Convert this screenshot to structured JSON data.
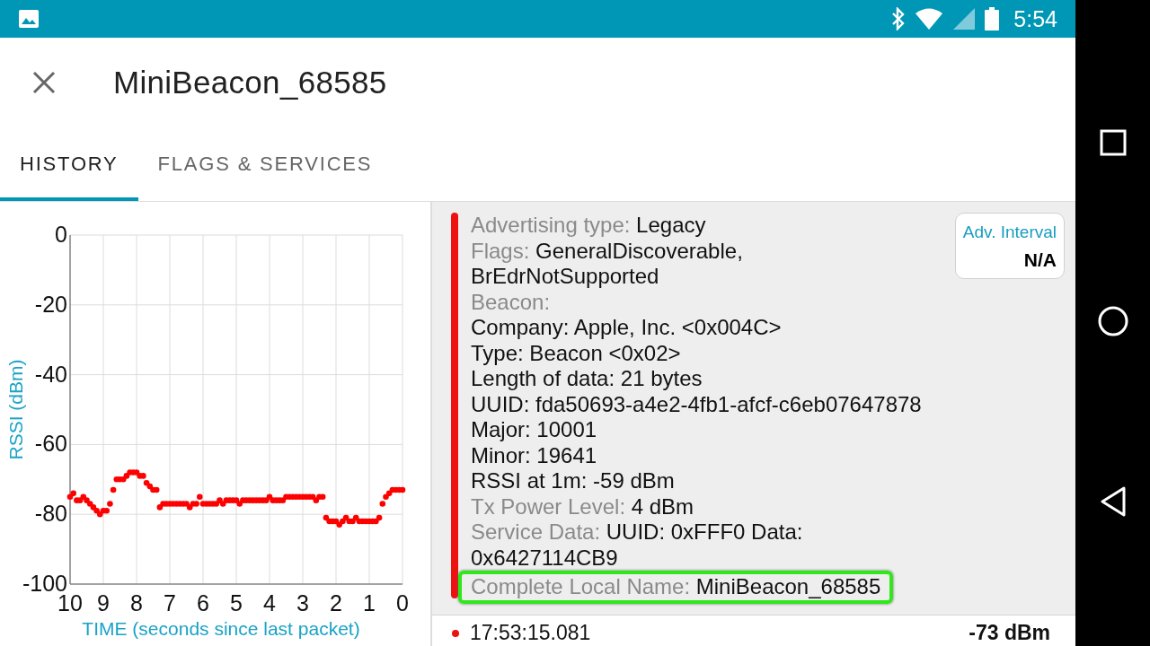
{
  "status_bar": {
    "time": "5:54"
  },
  "app_bar": {
    "title": "MiniBeacon_68585"
  },
  "tabs": [
    {
      "label": "HISTORY",
      "selected": true
    },
    {
      "label": "FLAGS & SERVICES",
      "selected": false
    }
  ],
  "history_chart": {
    "chart_data": {
      "type": "scatter",
      "grid": true,
      "xlabel": "TIME (seconds since last packet)",
      "ylabel": "RSSI (dBm)",
      "xlim": [
        10,
        0
      ],
      "ylim": [
        -100,
        0
      ],
      "xticks": [
        10,
        9,
        8,
        7,
        6,
        5,
        4,
        3,
        2,
        1,
        0
      ],
      "yticks": [
        0,
        -20,
        -40,
        -60,
        -80,
        -100
      ],
      "x": [
        10,
        9.9,
        9.8,
        9.7,
        9.6,
        9.5,
        9.4,
        9.3,
        9.2,
        9.1,
        9,
        8.9,
        8.8,
        8.7,
        8.6,
        8.5,
        8.4,
        8.3,
        8.2,
        8.1,
        8,
        7.9,
        7.8,
        7.7,
        7.6,
        7.5,
        7.4,
        7.3,
        7.2,
        7.1,
        7,
        6.9,
        6.8,
        6.7,
        6.6,
        6.5,
        6.4,
        6.3,
        6.2,
        6.1,
        6,
        5.9,
        5.8,
        5.7,
        5.6,
        5.5,
        5.4,
        5.3,
        5.2,
        5.1,
        5,
        4.9,
        4.8,
        4.7,
        4.6,
        4.5,
        4.4,
        4.3,
        4.2,
        4.1,
        4,
        3.9,
        3.8,
        3.7,
        3.6,
        3.5,
        3.4,
        3.3,
        3.2,
        3.1,
        3,
        2.9,
        2.8,
        2.7,
        2.6,
        2.5,
        2.4,
        2.3,
        2.2,
        2.1,
        2,
        1.9,
        1.8,
        1.7,
        1.6,
        1.5,
        1.4,
        1.3,
        1.2,
        1.1,
        1,
        0.9,
        0.8,
        0.7,
        0.6,
        0.5,
        0.4,
        0.3,
        0.2,
        0.1,
        0
      ],
      "series": [
        {
          "color": "#ff0000",
          "values": [
            -75,
            -74,
            -76,
            -76,
            -75,
            -76,
            -77,
            -78,
            -79,
            -80,
            -79,
            -79,
            -77,
            -73,
            -70,
            -70,
            -70,
            -69,
            -68,
            -68,
            -68,
            -69,
            -69,
            -71,
            -72,
            -73,
            -73,
            -78,
            -77,
            -77,
            -77,
            -77,
            -77,
            -77,
            -77,
            -77,
            -78,
            -77,
            -77,
            -75,
            -77,
            -77,
            -77,
            -77,
            -77,
            -76,
            -77,
            -76,
            -76,
            -76,
            -76,
            -77,
            -76,
            -76,
            -76,
            -76,
            -76,
            -76,
            -76,
            -76,
            -75,
            -76,
            -76,
            -76,
            -76,
            -75,
            -75,
            -75,
            -75,
            -75,
            -75,
            -75,
            -75,
            -75,
            -76,
            -75,
            -75,
            -81,
            -82,
            -82,
            -82,
            -83,
            -82,
            -81,
            -82,
            -82,
            -81,
            -82,
            -82,
            -82,
            -82,
            -82,
            -82,
            -81,
            -77,
            -75,
            -74,
            -73,
            -73,
            -73,
            -73
          ]
        }
      ]
    }
  },
  "packet": {
    "lines": [
      {
        "label": "Advertising type:",
        "value": "Legacy",
        "highlighted": false
      },
      {
        "label": "Flags:",
        "value": "GeneralDiscoverable, BrEdrNotSupported",
        "highlighted": false
      },
      {
        "label": "Beacon:",
        "highlighted": false
      },
      {
        "value": "Company: Apple, Inc. <0x004C>",
        "highlighted": false
      },
      {
        "value": "Type: Beacon <0x02>",
        "highlighted": false
      },
      {
        "value": "Length of data: 21 bytes",
        "highlighted": false
      },
      {
        "value": "UUID: fda50693-a4e2-4fb1-afcf-c6eb07647878",
        "highlighted": false
      },
      {
        "value": "Major: 10001",
        "highlighted": false
      },
      {
        "value": "Minor: 19641",
        "highlighted": false
      },
      {
        "value": "RSSI at 1m: -59 dBm",
        "highlighted": false
      },
      {
        "label": "Tx Power Level:",
        "value": "4 dBm",
        "highlighted": false
      },
      {
        "label": "Service Data:",
        "value": "UUID: 0xFFF0 Data: 0x6427114CB9",
        "highlighted": false
      },
      {
        "label": "Complete Local Name:",
        "value": "MiniBeacon_68585",
        "highlighted": true
      }
    ],
    "adv_interval": {
      "label": "Adv. Interval",
      "value": "N/A"
    }
  },
  "next_packet": {
    "time": "17:53:15.081",
    "rssi": "-73 dBm"
  }
}
